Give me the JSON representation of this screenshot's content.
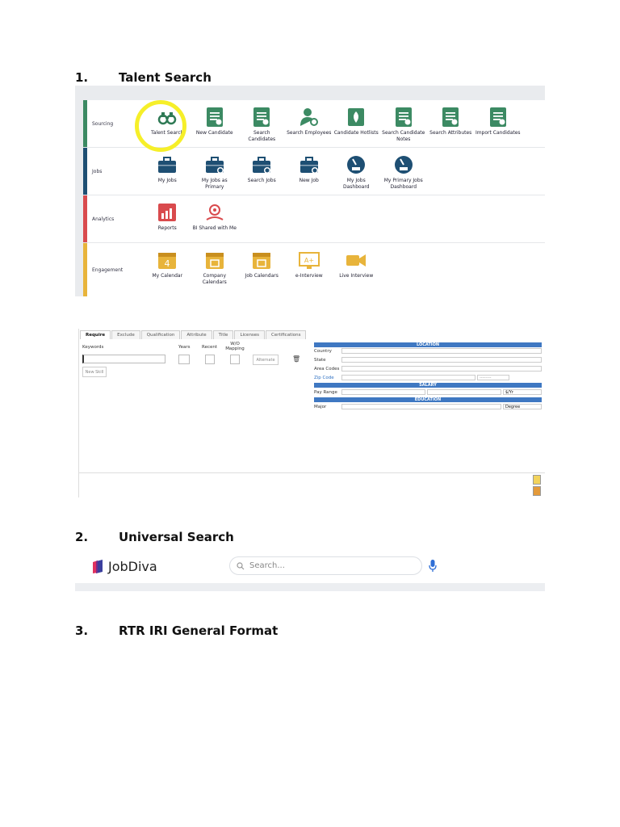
{
  "headings": [
    {
      "num": "1.",
      "title": "Talent Search"
    },
    {
      "num": "2.",
      "title": "Universal Search"
    },
    {
      "num": "3.",
      "title": "RTR IRI General Format"
    }
  ],
  "colors": {
    "sourcing": "#3c8a63",
    "jobs": "#1e4f73",
    "analytics": "#d94a4d",
    "engagement": "#e8b43b",
    "highlight": "#f6ef29"
  },
  "launcher": {
    "rows": [
      {
        "label": "Sourcing",
        "color": "#3c8a63",
        "tiles": [
          {
            "label": "Talent Search",
            "icon": "binoculars-icon"
          },
          {
            "label": "New Candidate",
            "icon": "new-candidate-icon"
          },
          {
            "label": "Search Candidates",
            "icon": "search-candidates-icon"
          },
          {
            "label": "Search Employees",
            "icon": "search-employees-icon"
          },
          {
            "label": "Candidate Hotlists",
            "icon": "hotlist-icon"
          },
          {
            "label": "Search Candidate Notes",
            "icon": "notes-search-icon"
          },
          {
            "label": "Search Attributes",
            "icon": "attributes-search-icon"
          },
          {
            "label": "Import Candidates",
            "icon": "import-icon"
          }
        ]
      },
      {
        "label": "Jobs",
        "color": "#1e4f73",
        "tiles": [
          {
            "label": "My Jobs",
            "icon": "briefcase-icon"
          },
          {
            "label": "My Jobs as Primary",
            "icon": "briefcase-primary-icon"
          },
          {
            "label": "Search Jobs",
            "icon": "briefcase-search-icon"
          },
          {
            "label": "New Job",
            "icon": "briefcase-add-icon"
          },
          {
            "label": "My Jobs Dashboard",
            "icon": "dashboard-gauge-icon"
          },
          {
            "label": "My Primary Jobs Dashboard",
            "icon": "dashboard-gauge-primary-icon"
          }
        ]
      },
      {
        "label": "Analytics",
        "color": "#d94a4d",
        "tiles": [
          {
            "label": "Reports",
            "icon": "reports-chart-icon"
          },
          {
            "label": "BI Shared with Me",
            "icon": "bi-shared-icon"
          }
        ]
      },
      {
        "label": "Engagement",
        "color": "#e8b43b",
        "tiles": [
          {
            "label": "My Calendar",
            "icon": "calendar-icon"
          },
          {
            "label": "Company Calendars",
            "icon": "company-calendar-icon"
          },
          {
            "label": "Job Calendars",
            "icon": "job-calendar-icon"
          },
          {
            "label": "e-Interview",
            "icon": "e-interview-icon"
          },
          {
            "label": "Live Interview",
            "icon": "video-camera-icon"
          }
        ]
      }
    ]
  },
  "talent_form": {
    "tabs": [
      "Require",
      "Exclude",
      "Qualification",
      "Attribute",
      "Title",
      "Licenses",
      "Certifications"
    ],
    "keywords_label": "Keywords",
    "years_label": "Years",
    "recent_label": "Recent",
    "mapping_label": "W/O Mapping",
    "alternate_label": "Alternate",
    "new_skill_label": "New Skill",
    "location_header": "LOCATION",
    "country_label": "Country",
    "state_label": "State",
    "area_codes_label": "Area Codes",
    "zip_label": "Zip Code",
    "zip_unit": "--------",
    "salary_header": "SALARY",
    "pay_range_label": "Pay Range",
    "pay_unit": "$/Yr",
    "education_header": "EDUCATION",
    "major_label": "Major",
    "degree_label": "Degree"
  },
  "universal_search": {
    "brand": "JobDiva",
    "placeholder": "Search..."
  }
}
